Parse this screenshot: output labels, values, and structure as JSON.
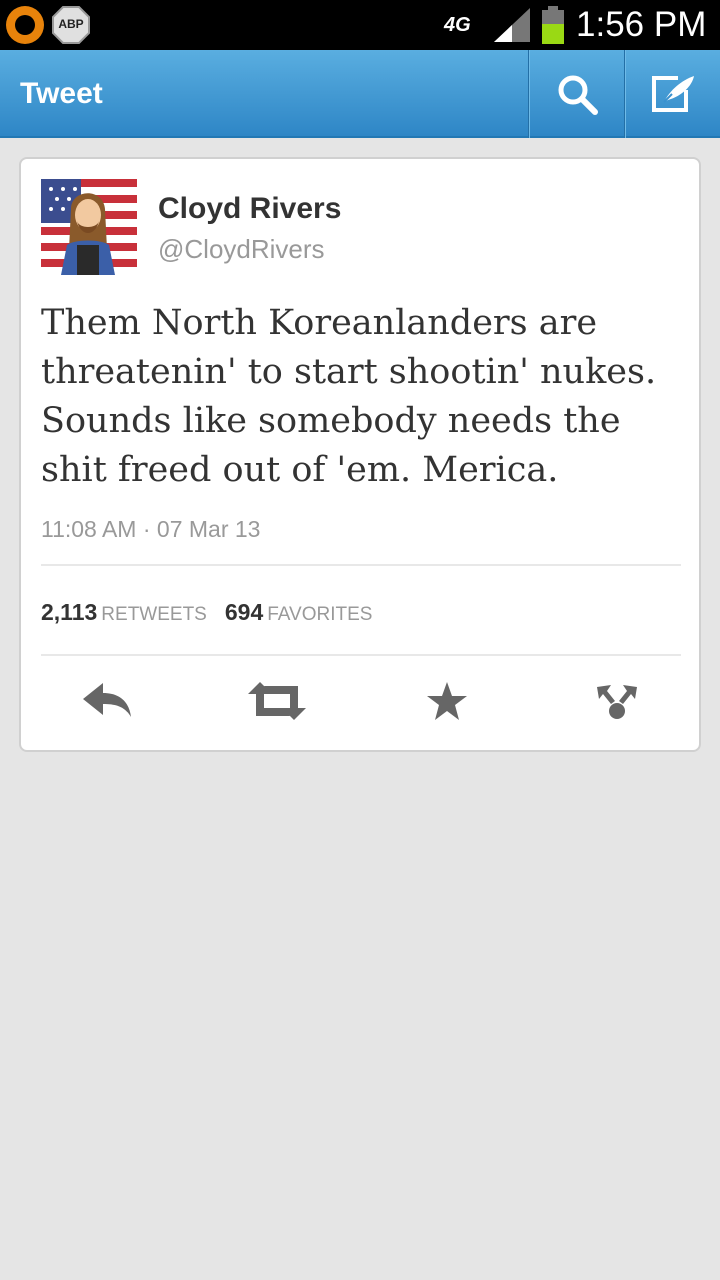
{
  "status_bar": {
    "abp_label": "ABP",
    "network": "4G",
    "time": "1:56 PM"
  },
  "action_bar": {
    "title": "Tweet",
    "icons": [
      "search-icon",
      "compose-icon"
    ],
    "color": "#3d99d5"
  },
  "tweet": {
    "name": "Cloyd Rivers",
    "handle": "@CloydRivers",
    "text": "Them North Koreanlanders are threatenin' to start shootin' nukes. Sounds like somebody needs the shit freed out of 'em. Merica.",
    "timestamp": "11:08 AM · 07 Mar 13",
    "retweets_count": "2,113",
    "retweets_label": "RETWEETS",
    "favorites_count": "694",
    "favorites_label": "FAVORITES",
    "actions": [
      "reply-icon",
      "retweet-icon",
      "favorite-icon",
      "share-icon"
    ]
  }
}
